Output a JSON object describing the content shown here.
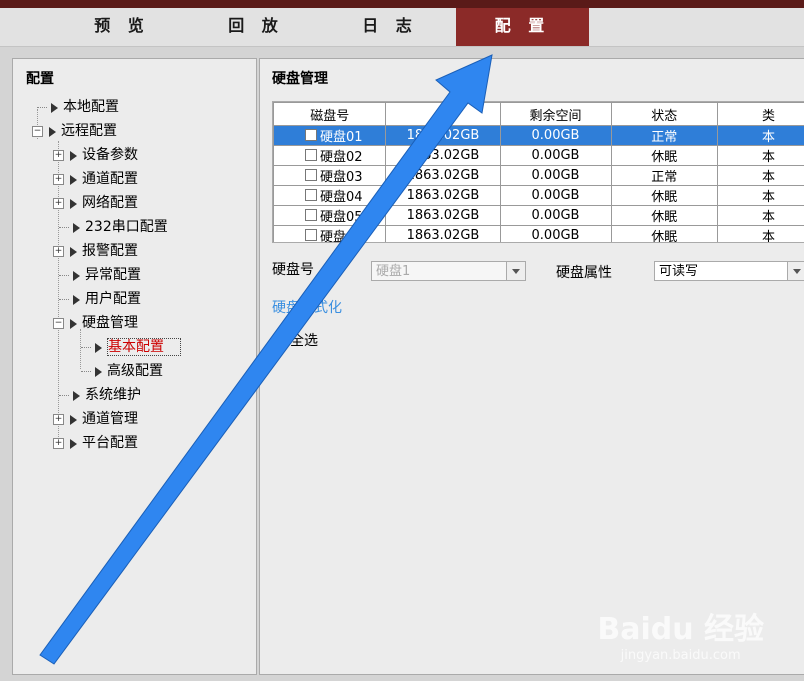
{
  "tabs": [
    {
      "label": "预 览"
    },
    {
      "label": "回 放"
    },
    {
      "label": "日 志"
    },
    {
      "label": "配 置"
    }
  ],
  "left_panel": {
    "title": "配置",
    "tree": [
      {
        "label": "本地配置"
      },
      {
        "label": "远程配置"
      },
      {
        "label": "设备参数"
      },
      {
        "label": "通道配置"
      },
      {
        "label": "网络配置"
      },
      {
        "label": "232串口配置"
      },
      {
        "label": "报警配置"
      },
      {
        "label": "异常配置"
      },
      {
        "label": "用户配置"
      },
      {
        "label": "硬盘管理"
      },
      {
        "label": "基本配置"
      },
      {
        "label": "高级配置"
      },
      {
        "label": "系统维护"
      },
      {
        "label": "通道管理"
      },
      {
        "label": "平台配置"
      }
    ]
  },
  "main": {
    "title": "硬盘管理",
    "table": {
      "headers": [
        "磁盘号",
        "",
        "剩余空间",
        "状态",
        "类"
      ],
      "rows": [
        {
          "disk": "硬盘01",
          "capacity": "1863.02GB",
          "free": "0.00GB",
          "status": "正常",
          "type": "本"
        },
        {
          "disk": "硬盘02",
          "capacity": "1863.02GB",
          "free": "0.00GB",
          "status": "休眠",
          "type": "本"
        },
        {
          "disk": "硬盘03",
          "capacity": "1863.02GB",
          "free": "0.00GB",
          "status": "正常",
          "type": "本"
        },
        {
          "disk": "硬盘04",
          "capacity": "1863.02GB",
          "free": "0.00GB",
          "status": "休眠",
          "type": "本"
        },
        {
          "disk": "硬盘05",
          "capacity": "1863.02GB",
          "free": "0.00GB",
          "status": "休眠",
          "type": "本"
        },
        {
          "disk": "硬盘06",
          "capacity": "1863.02GB",
          "free": "0.00GB",
          "status": "休眠",
          "type": "本"
        }
      ]
    },
    "disk_label": "硬盘号",
    "disk_value": "硬盘1",
    "attr_label": "硬盘属性",
    "attr_value": "可读写",
    "format_link": "硬盘格式化",
    "select_all": "全选"
  },
  "watermark": {
    "logo": "Baidu 经验",
    "url": "jingyan.baidu.com"
  },
  "colors": {
    "active_tab": "#8b2a28",
    "selected_row": "#2f7ed8",
    "arrow": "#2f86f0",
    "link": "#3a8fe0"
  }
}
